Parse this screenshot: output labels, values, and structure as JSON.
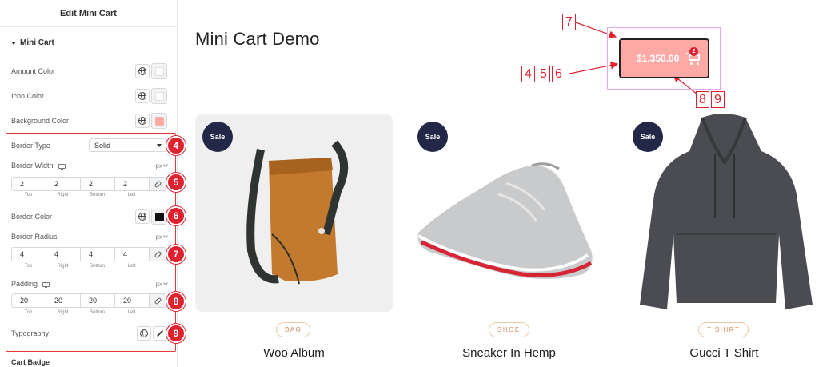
{
  "sidebar": {
    "header": "Edit Mini Cart",
    "section": "Mini Cart",
    "amount_color": "Amount Color",
    "icon_color": "Icon Color",
    "background_color": "Background Color",
    "border_type": {
      "label": "Border Type",
      "value": "Solid"
    },
    "border_width": {
      "label": "Border Width",
      "unit": "px",
      "top": "2",
      "right": "2",
      "bottom": "2",
      "left": "2"
    },
    "border_color": "Border Color",
    "border_radius": {
      "label": "Border Radius",
      "unit": "px",
      "top": "4",
      "right": "4",
      "bottom": "4",
      "left": "4"
    },
    "padding": {
      "label": "Padding",
      "unit": "px",
      "top": "20",
      "right": "20",
      "bottom": "20",
      "left": "20"
    },
    "dim_labels": {
      "top": "Top",
      "right": "Right",
      "bottom": "Bottom",
      "left": "Left"
    },
    "typography": "Typography",
    "cart_badge": "Cart Badge",
    "steps": {
      "s4": "4",
      "s5": "5",
      "s6": "6",
      "s7": "7",
      "s8": "8",
      "s9": "9"
    },
    "colors": {
      "amount": "#ffffff",
      "icon": "#ffffff",
      "background": "#ffa9a7",
      "border": "#111111"
    }
  },
  "main": {
    "title": "Mini Cart Demo",
    "cart": {
      "amount": "$1,350.00",
      "count": "2"
    },
    "callouts": {
      "n7": "7",
      "n4": "4",
      "n5": "5",
      "n6": "6",
      "n8": "8",
      "n9": "9"
    },
    "products": [
      {
        "sale": "Sale",
        "tag": "BAG",
        "name": "Woo Album"
      },
      {
        "sale": "Sale",
        "tag": "SHOE",
        "name": "Sneaker In Hemp"
      },
      {
        "sale": "Sale",
        "tag": "T SHIRT",
        "name": "Gucci T Shirt"
      }
    ]
  }
}
